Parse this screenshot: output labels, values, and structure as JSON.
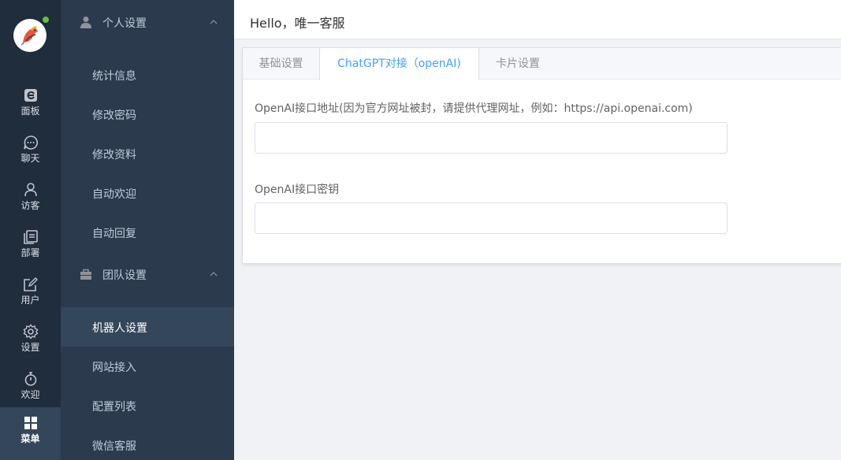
{
  "rail": {
    "items": [
      {
        "label": "面板",
        "icon": "dashboard-icon"
      },
      {
        "label": "聊天",
        "icon": "chat-icon"
      },
      {
        "label": "访客",
        "icon": "visitor-icon"
      },
      {
        "label": "部署",
        "icon": "deploy-icon"
      },
      {
        "label": "用户",
        "icon": "user-edit-icon"
      },
      {
        "label": "设置",
        "icon": "gear-icon"
      },
      {
        "label": "欢迎",
        "icon": "stopwatch-icon"
      },
      {
        "label": "菜单",
        "icon": "grid-icon"
      }
    ],
    "active_index": 7
  },
  "submenu": {
    "groups": [
      {
        "title": "个人设置",
        "icon": "person-icon",
        "items": [
          "统计信息",
          "修改密码",
          "修改资料",
          "自动欢迎",
          "自动回复"
        ]
      },
      {
        "title": "团队设置",
        "icon": "briefcase-icon",
        "items": [
          "机器人设置",
          "网站接入",
          "配置列表",
          "微信客服"
        ]
      }
    ],
    "active_item": "机器人设置"
  },
  "header": {
    "greeting": "Hello，唯一客服"
  },
  "tabs": [
    "基础设置",
    "ChatGPT对接（openAI)",
    "卡片设置"
  ],
  "active_tab": 1,
  "form": {
    "api_url_label": "OpenAI接口地址(因为官方网址被封，请提供代理网址，例如：https://api.openai.com)",
    "api_url_value": "",
    "api_key_label": "OpenAI接口密钥",
    "api_key_value": ""
  },
  "colors": {
    "rail_bg": "#1f2d3d",
    "submenu_bg": "#2b3a4d",
    "active_bg": "#34465a",
    "accent": "#409eff",
    "online": "#67c23a"
  }
}
